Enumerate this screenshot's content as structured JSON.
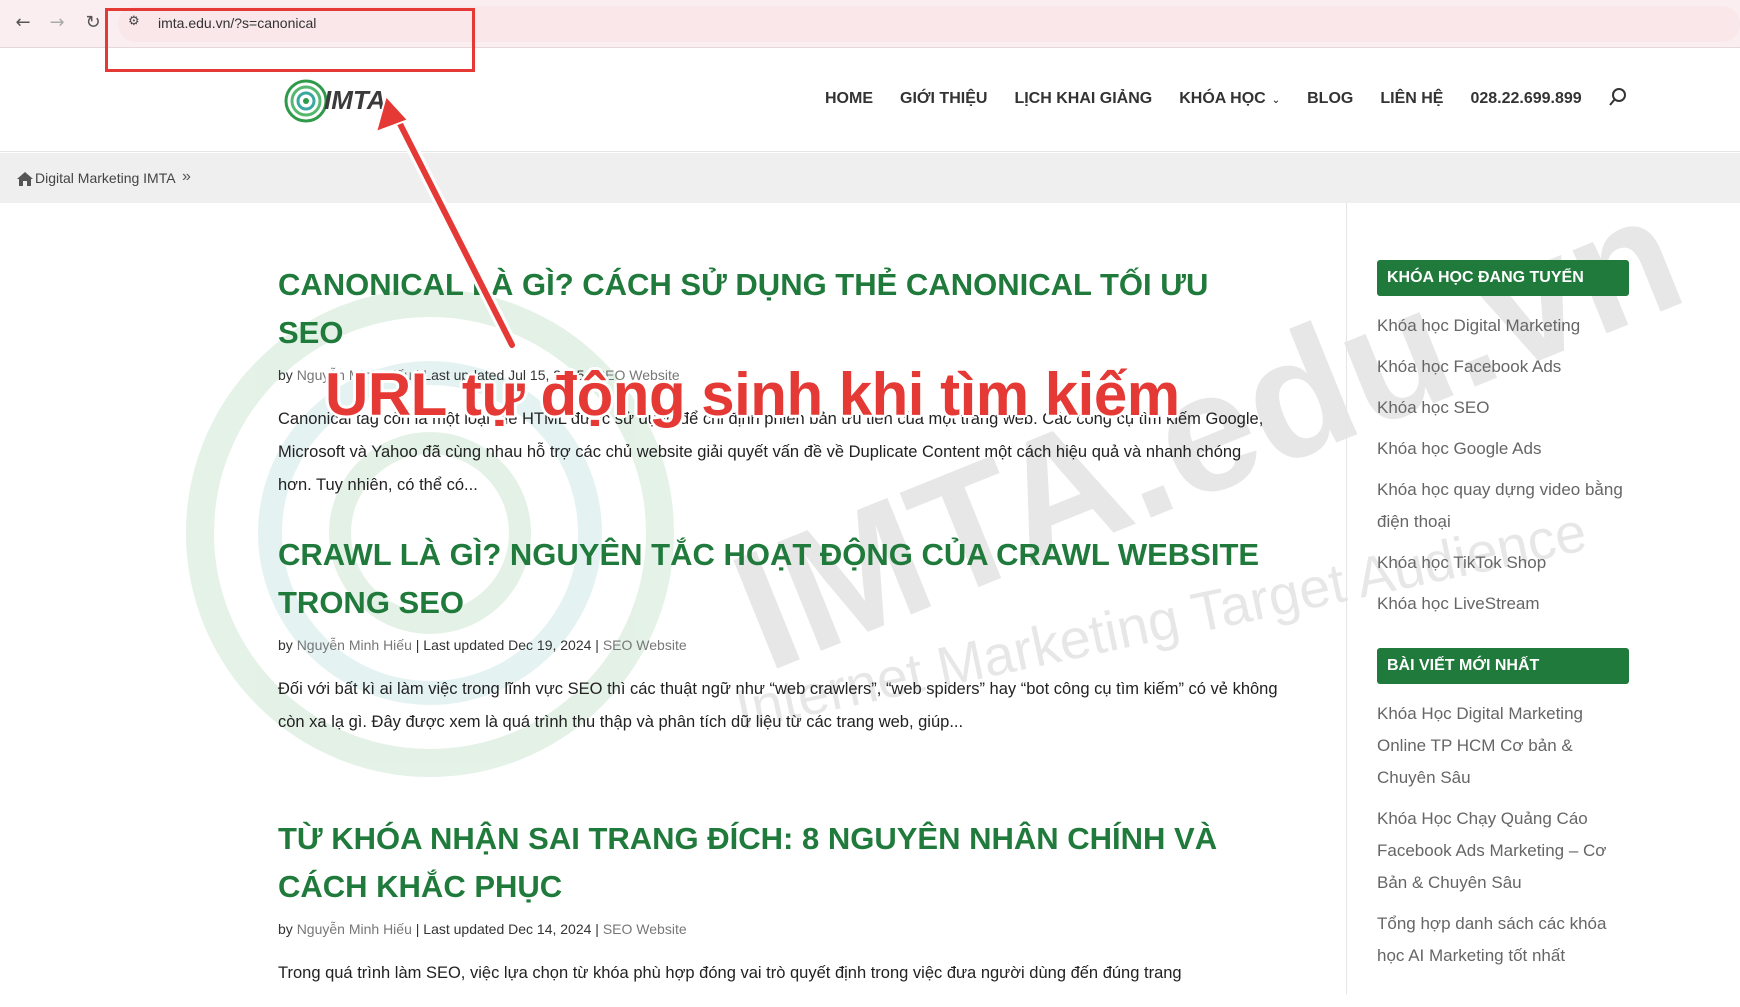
{
  "browser": {
    "back_icon": "arrow-left-icon",
    "forward_icon": "arrow-right-icon",
    "reload_icon": "reload-icon",
    "url": "imta.edu.vn/?s=canonical"
  },
  "header": {
    "logo_text": "IMTA",
    "menu": [
      {
        "label": "HOME"
      },
      {
        "label": "GIỚI THIỆU"
      },
      {
        "label": "LỊCH KHAI GIẢNG"
      },
      {
        "label": "KHÓA HỌC"
      },
      {
        "label": "BLOG"
      },
      {
        "label": "LIÊN HỆ"
      },
      {
        "label": "028.22.699.899"
      }
    ]
  },
  "breadcrumb": {
    "home_label": "Digital Marketing IMTA",
    "separator": "»"
  },
  "watermark": {
    "main": "IMTA.edu.vn",
    "tagline": "Internet Marketing Target Audience"
  },
  "posts": [
    {
      "title": "CANONICAL LÀ GÌ? CÁCH SỬ DỤNG THẺ CANONICAL TỐI ƯU SEO",
      "by": "by",
      "author": "Nguyễn Minh Hiếu",
      "updated": "Last updated Jul 15, 2025",
      "category": "SEO Website",
      "excerpt": "Canonical tag còn là một loại thẻ HTML được sử dụng để chỉ định phiên bản ưu tiên của một trang web. Các công cụ tìm kiếm Google, Microsoft và Yahoo đã cùng nhau hỗ trợ các chủ website giải quyết vấn đề về Duplicate Content một cách hiệu quả và nhanh chóng hơn. Tuy nhiên, có thể có..."
    },
    {
      "title": "CRAWL LÀ GÌ? NGUYÊN TẮC HOẠT ĐỘNG CỦA CRAWL WEBSITE TRONG SEO",
      "by": "by",
      "author": "Nguyễn Minh Hiếu",
      "updated": "Last updated Dec 19, 2024",
      "category": "SEO Website",
      "excerpt": "Đối với bất kì ai làm việc trong lĩnh vực SEO thì các thuật ngữ như “web crawlers”, “web spiders” hay “bot công cụ tìm kiếm” có vẻ không còn xa lạ gì. Đây được xem là quá trình thu thập và phân tích dữ liệu từ các trang web, giúp..."
    },
    {
      "title": "TỪ KHÓA NHẬN SAI TRANG ĐÍCH: 8 NGUYÊN NHÂN CHÍNH VÀ CÁCH KHẮC PHỤC",
      "by": "by",
      "author": "Nguyễn Minh Hiếu",
      "updated": "Last updated Dec 14, 2024",
      "category": "SEO Website",
      "excerpt": "Trong quá trình làm SEO, việc lựa chọn từ khóa phù hợp đóng vai trò quyết định trong việc đưa người dùng đến đúng trang"
    }
  ],
  "sidebar": {
    "courses_title": "KHÓA HỌC ĐANG TUYỂN",
    "courses": [
      "Khóa học Digital Marketing",
      "Khóa học Facebook Ads",
      "Khóa học SEO",
      "Khóa học Google Ads",
      "Khóa học quay dựng video bằng điện thoại",
      "Khóa học TikTok Shop",
      "Khóa học LiveStream"
    ],
    "posts_title": "BÀI VIẾT MỚI NHẤT",
    "recent_posts": [
      "Khóa Học Digital Marketing Online TP HCM Cơ bản & Chuyên Sâu",
      "Khóa Học Chạy Quảng Cáo Facebook Ads Marketing – Cơ Bản & Chuyên Sâu",
      "Tổng hợp danh sách các khóa học AI Marketing tốt nhất"
    ]
  },
  "annotation": {
    "caption": "URL tự động sinh khi tìm kiếm",
    "color": "#e53935"
  },
  "colors": {
    "brand_green": "#1f7a3b",
    "chrome_bg": "#fbeef0"
  }
}
